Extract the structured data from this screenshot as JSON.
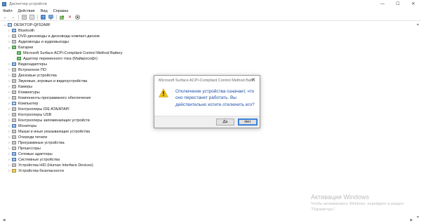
{
  "window": {
    "title": "Диспетчер устройств",
    "controls": {
      "minimize": "—",
      "maximize": "☐",
      "close": "✕"
    }
  },
  "menu": [
    "Файл",
    "Действие",
    "Вид",
    "Справка"
  ],
  "toolbar_icons": [
    "back-arrow-icon",
    "forward-arrow-icon",
    "properties-icon",
    "list-icon",
    "help-icon",
    "monitor-icon",
    "update-driver-icon",
    "uninstall-x-icon",
    "disable-device-icon"
  ],
  "tree": {
    "root": "DESKTOP-QF52A8F",
    "items": [
      {
        "label": "Bluetooth",
        "expanded": false
      },
      {
        "label": "DVD-дисководы и дисководы компакт-дисков",
        "expanded": false
      },
      {
        "label": "Аудиовходы и аудиовыходы",
        "expanded": false
      },
      {
        "label": "Батареи",
        "expanded": true,
        "children": [
          "Microsoft Surface ACPI-Compliant Control Method Battery",
          "Адаптер переменного тока (Майкрософт)"
        ]
      },
      {
        "label": "Видеоадаптеры",
        "expanded": false
      },
      {
        "label": "Встроенное ПО",
        "expanded": false
      },
      {
        "label": "Дисковые устройства",
        "expanded": false
      },
      {
        "label": "Звуковые, игровые и видеоустройства",
        "expanded": false
      },
      {
        "label": "Камеры",
        "expanded": false
      },
      {
        "label": "Клавиатуры",
        "expanded": false
      },
      {
        "label": "Компоненты программного обеспечения",
        "expanded": false
      },
      {
        "label": "Компьютер",
        "expanded": false
      },
      {
        "label": "Контроллеры IDE ATA/ATAPI",
        "expanded": false
      },
      {
        "label": "Контроллеры USB",
        "expanded": false
      },
      {
        "label": "Контроллеры запоминающих устройств",
        "expanded": false
      },
      {
        "label": "Мониторы",
        "expanded": false
      },
      {
        "label": "Мыши и иные указывающие устройства",
        "expanded": false
      },
      {
        "label": "Очереди печати",
        "expanded": false
      },
      {
        "label": "Программные устройства",
        "expanded": false
      },
      {
        "label": "Процессоры",
        "expanded": false
      },
      {
        "label": "Сетевые адаптеры",
        "expanded": false
      },
      {
        "label": "Системные устройства",
        "expanded": false
      },
      {
        "label": "Устройства HID (Human Interface Devices)",
        "expanded": false
      },
      {
        "label": "Устройства безопасности",
        "expanded": false
      }
    ]
  },
  "dialog": {
    "title": "Microsoft Surface ACPI-Compliant Control Method Batt...",
    "close": "✕",
    "message": "Отключение устройства означает, что оно перестанет работать. Вы действительно хотите отключить его?",
    "yes_label": "Да",
    "no_label": "Нет"
  },
  "watermark": {
    "heading": "Активация Windows",
    "text": "Чтобы активировать Windows, перейдите в раздел \"Параметры\"."
  },
  "colors": {
    "accent": "#2b73cf",
    "dialog_text": "#1f4fa8",
    "warning": "#f0c419"
  }
}
